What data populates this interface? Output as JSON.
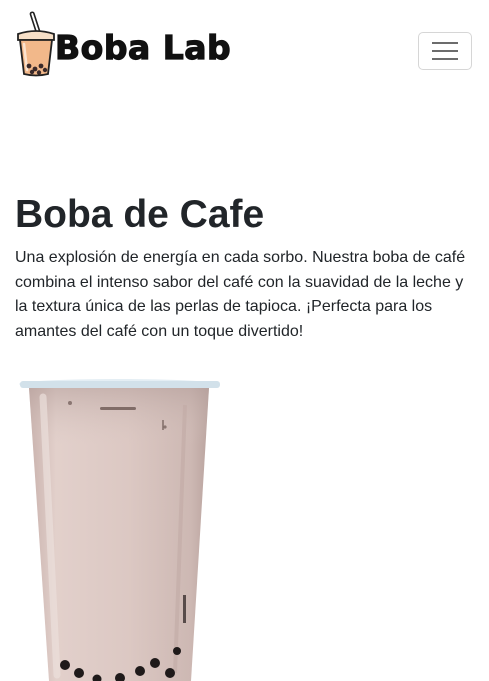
{
  "navbar": {
    "brand_name": "Boba Lab",
    "logo_icon": "boba-cup-logo-icon",
    "menu_icon": "hamburger-menu-icon"
  },
  "product": {
    "title": "Boba de Cafe",
    "description": "Una explosión de energía en cada sorbo. Nuestra boba de café combina el intenso sabor del café con la suavidad de la leche y la textura única de las perlas de tapioca. ¡Perfecta para los amantes del café con un toque divertido!",
    "image_icon": "coffee-boba-drink-image"
  },
  "colors": {
    "text": "#212529",
    "cup_fill": "#f2b88a",
    "drink_milk": "#d8c2bd",
    "lid": "#d9e6ee",
    "toggler_border": "#d6d6d6"
  }
}
